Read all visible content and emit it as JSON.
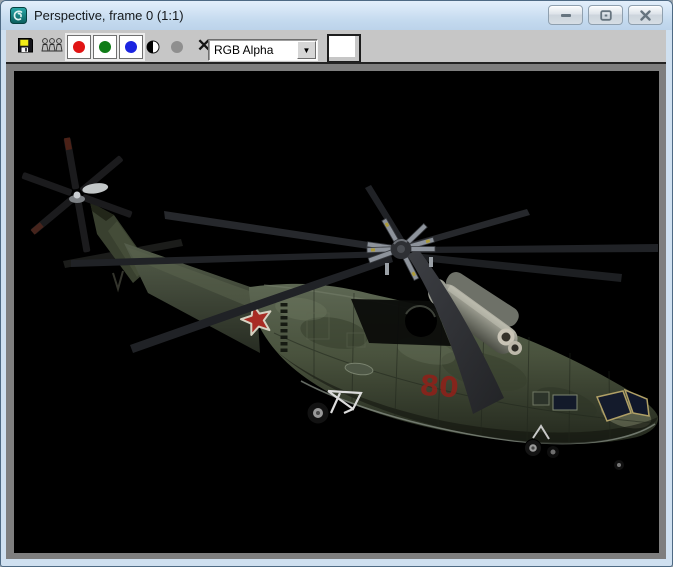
{
  "window": {
    "title": "Perspective, frame 0 (1:1)",
    "app_icon": "3dsmax-logo",
    "controls": {
      "minimize": "minimize",
      "maximize": "maximize",
      "close": "close"
    }
  },
  "toolbar": {
    "save_button": {
      "icon": "floppy-disk-icon"
    },
    "clone_button": {
      "icon": "clone-window-icon"
    },
    "channels": [
      {
        "name": "red-channel",
        "color": "#e11414",
        "pressed": true
      },
      {
        "name": "green-channel",
        "color": "#0f7c17",
        "pressed": true
      },
      {
        "name": "blue-channel",
        "color": "#1b24e0",
        "pressed": true
      }
    ],
    "mono_button": {
      "name": "monochrome",
      "left_color": "#000000",
      "right_color": "#ffffff"
    },
    "alpha_button": {
      "name": "alpha",
      "color": "#8f8f8f",
      "enabled": false
    },
    "clear_button": {
      "glyph": "✕"
    },
    "display_select": {
      "value": "RGB Alpha",
      "arrow": "▼"
    },
    "color_swatch": {
      "color": "#ffffff"
    }
  },
  "viewport": {
    "background": "#000000",
    "frame_color": "#7e7e7e",
    "scene": {
      "subject": "Soviet heavy transport helicopter (Mi-26 style), front-left 3/4 render on black",
      "tail_number": "80",
      "tail_number_color": "#8c221a",
      "camo_base_color": "#4c553f",
      "star_color": "#a82c24"
    }
  },
  "colors": {
    "titlebar": "#c3d9ee",
    "toolbar_bg": "#c6c6c6",
    "viewport_frame": "#7e7e7e",
    "window_frame": "#cfe0f0"
  }
}
